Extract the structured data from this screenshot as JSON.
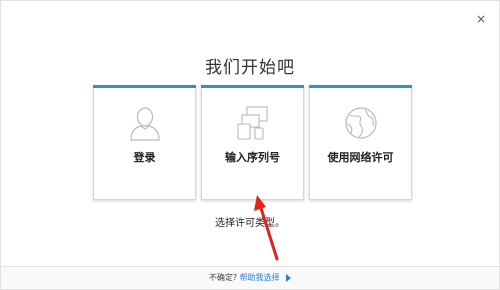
{
  "dialog": {
    "title": "我们开始吧",
    "close_symbol": "×",
    "hint": "选择许可类型。"
  },
  "cards": [
    {
      "label": "登录",
      "icon": "user-silhouette-icon"
    },
    {
      "label": "输入序列号",
      "icon": "devices-icon"
    },
    {
      "label": "使用网络许可",
      "icon": "globe-icon"
    }
  ],
  "footer": {
    "question": "不确定?",
    "help_link": "帮助我选择"
  },
  "colors": {
    "accent": "#2e8fd6",
    "arrow": "#e0231b",
    "link": "#2e7fc9"
  }
}
